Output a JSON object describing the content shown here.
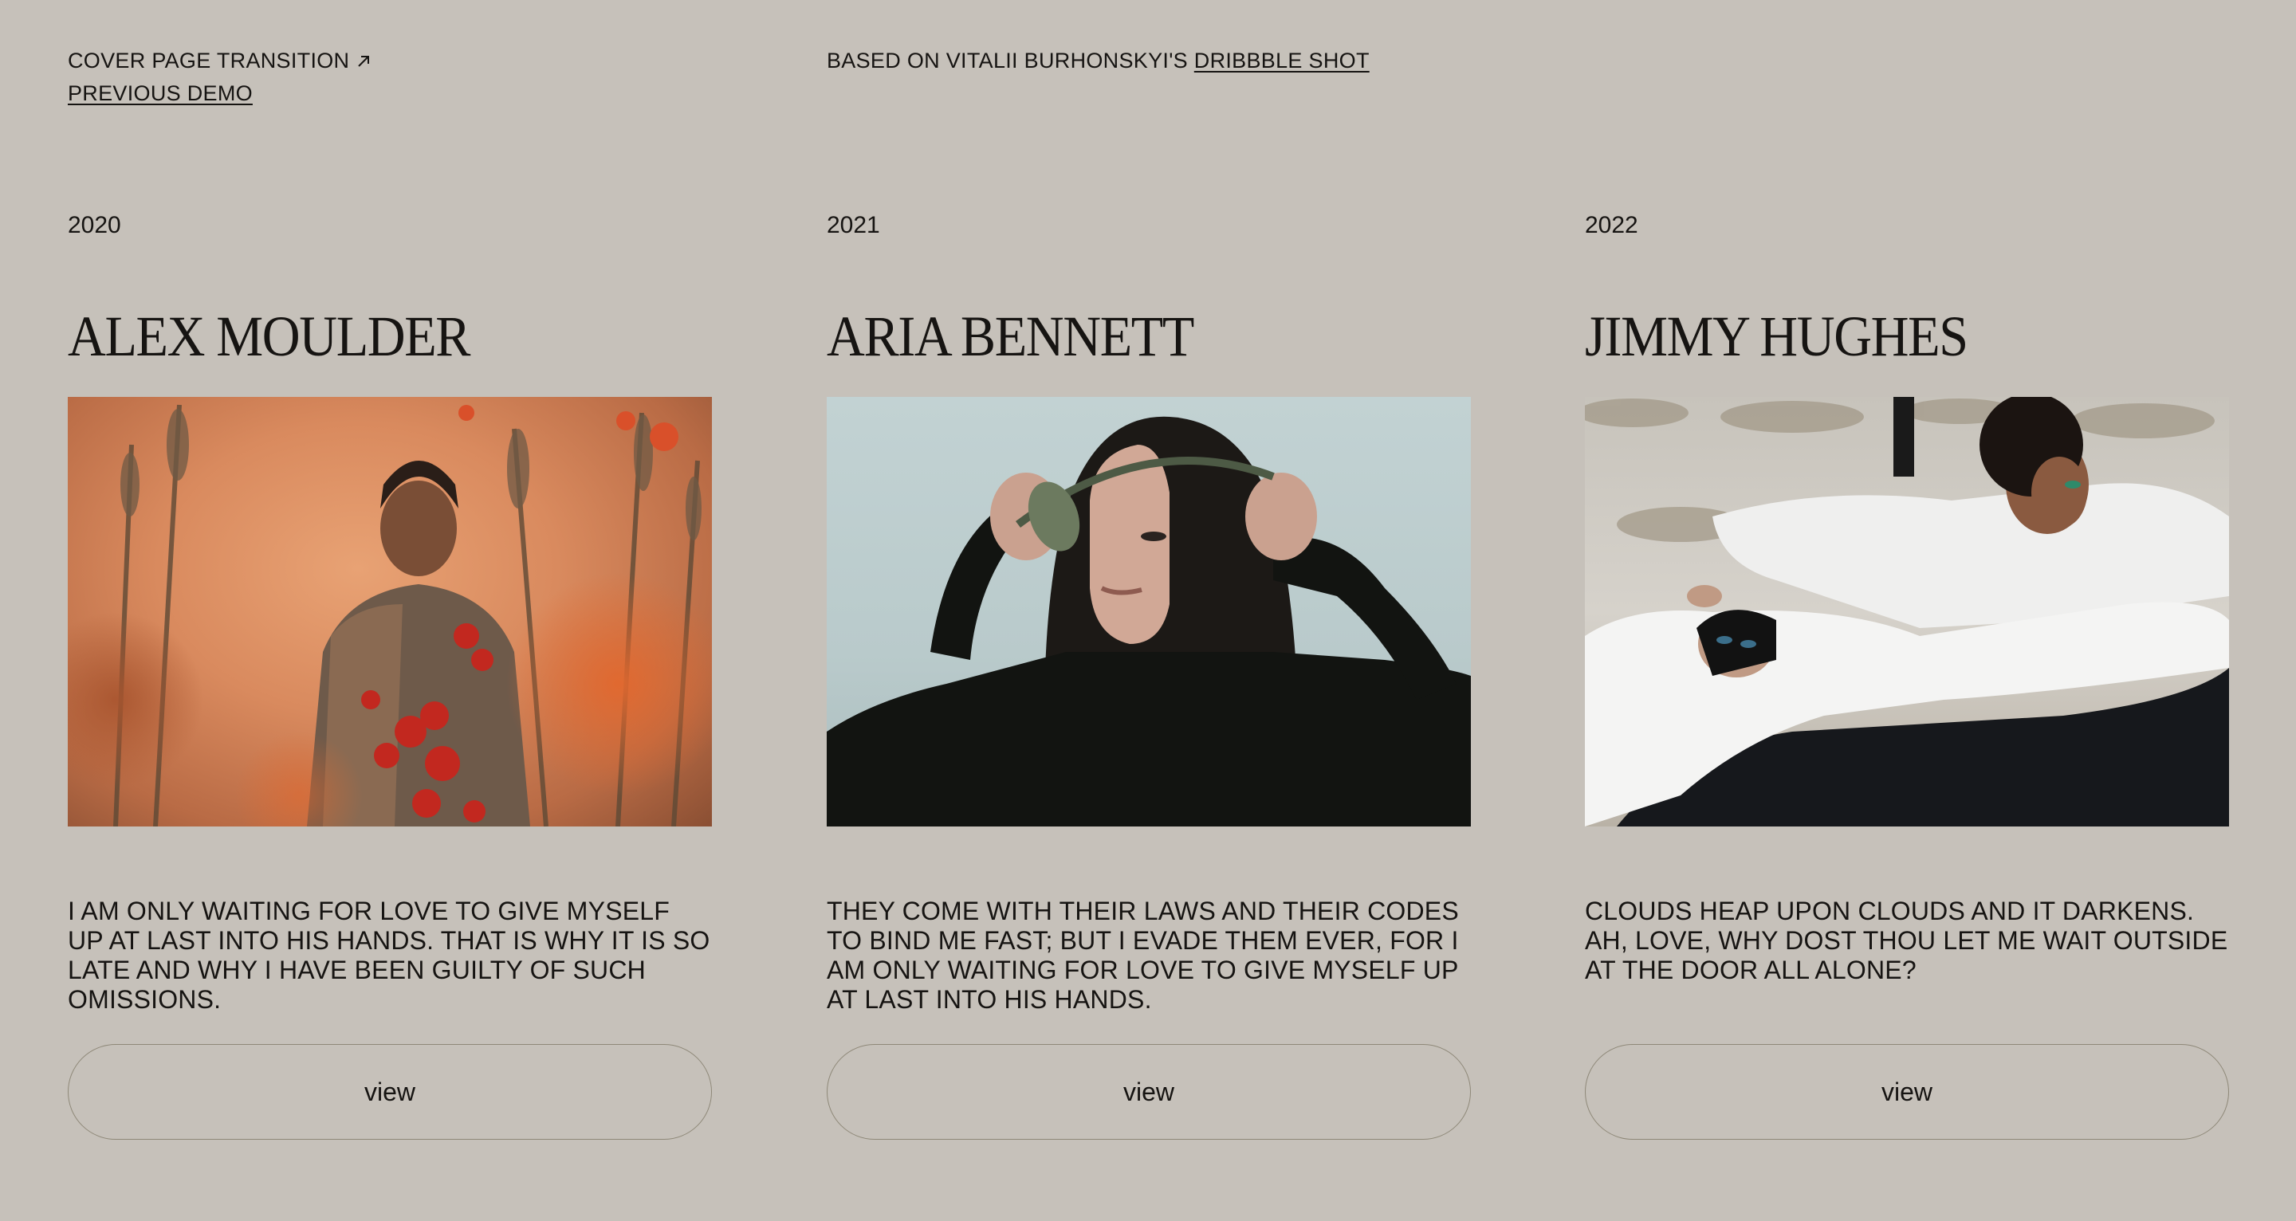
{
  "header": {
    "transition_link": "COVER PAGE TRANSITION",
    "previous_demo": "PREVIOUS DEMO",
    "credit_prefix": "BASED ON VITALII BURHONSKYI'S",
    "credit_link": "DRIBBBLE SHOT"
  },
  "cards": [
    {
      "year": "2020",
      "name": "ALEX MOULDER",
      "description": "I AM ONLY WAITING FOR LOVE TO GIVE MYSELF UP AT LAST INTO HIS HANDS. THAT IS WHY IT IS SO LATE AND WHY I HAVE BEEN GUILTY OF SUCH OMISSIONS.",
      "button": "view"
    },
    {
      "year": "2021",
      "name": "ARIA BENNETT",
      "description": "THEY COME WITH THEIR LAWS AND THEIR CODES TO BIND ME FAST; BUT I EVADE THEM EVER, FOR I AM ONLY WAITING FOR LOVE TO GIVE MYSELF UP AT LAST INTO HIS HANDS.",
      "button": "view"
    },
    {
      "year": "2022",
      "name": "JIMMY HUGHES",
      "description": "CLOUDS HEAP UPON CLOUDS AND IT DARKENS. AH, LOVE, WHY DOST THOU LET ME WAIT OUTSIDE AT THE DOOR ALL ALONE?",
      "button": "view"
    }
  ],
  "colors": {
    "background": "#c6c1ba",
    "text": "#161412",
    "button_border": "#8e8878"
  },
  "icons": {
    "transition_link": "arrow-up-right-icon"
  }
}
